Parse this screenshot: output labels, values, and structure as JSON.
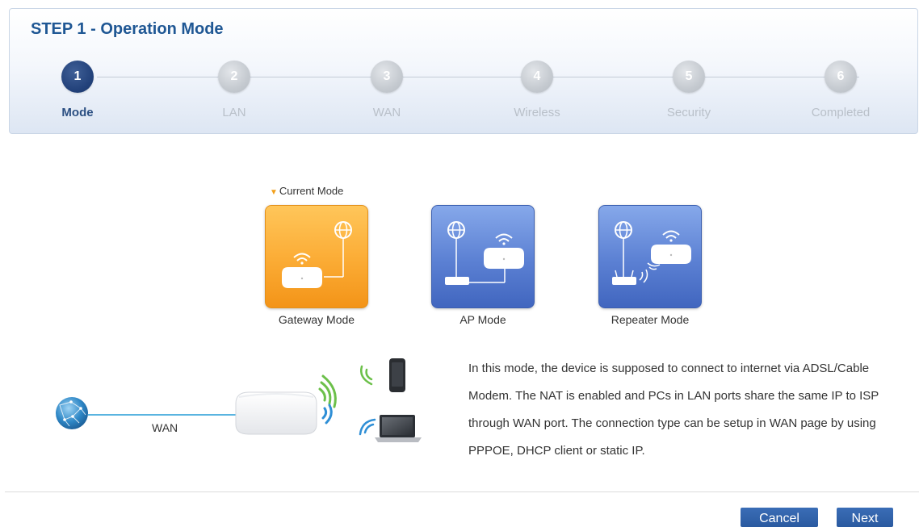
{
  "wizard": {
    "title": "STEP 1 - Operation Mode",
    "steps": [
      {
        "number": "1",
        "label": "Mode",
        "active": true
      },
      {
        "number": "2",
        "label": "LAN",
        "active": false
      },
      {
        "number": "3",
        "label": "WAN",
        "active": false
      },
      {
        "number": "4",
        "label": "Wireless",
        "active": false
      },
      {
        "number": "5",
        "label": "Security",
        "active": false
      },
      {
        "number": "6",
        "label": "Completed",
        "active": false
      }
    ]
  },
  "modes": {
    "current_label": "Current Mode",
    "items": [
      {
        "label": "Gateway Mode",
        "icon": "gateway-mode-icon",
        "color": "#f7a227",
        "selected": true
      },
      {
        "label": "AP Mode",
        "icon": "ap-mode-icon",
        "color": "#5577cc",
        "selected": false
      },
      {
        "label": "Repeater Mode",
        "icon": "repeater-mode-icon",
        "color": "#5577cc",
        "selected": false
      }
    ]
  },
  "diagram": {
    "wan_label": "WAN"
  },
  "description": "In this mode, the device is supposed to connect to internet via ADSL/Cable Modem. The NAT is enabled and PCs in LAN ports share the same IP to ISP through WAN port. The connection type can be setup in WAN page by using PPPOE, DHCP client or static IP.",
  "buttons": {
    "cancel": "Cancel",
    "next": "Next"
  },
  "colors": {
    "title": "#1f5794",
    "active_step": "#22417a",
    "button": "#2f62ab",
    "wan_line": "#5ab4e0"
  }
}
